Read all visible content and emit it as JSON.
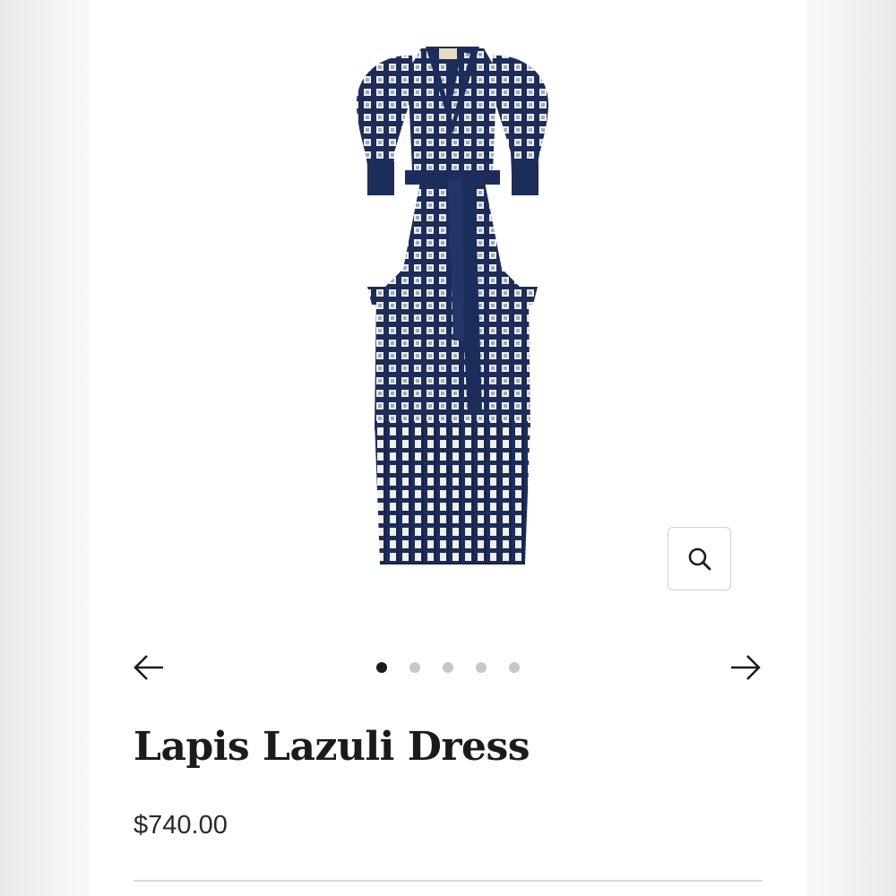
{
  "product": {
    "title": "Lapis Lazuli Dress",
    "price": "$740.00",
    "image": {
      "subject": "navy-blue-white-check-tiered-dress",
      "colors": {
        "primary": "#1c2d5c",
        "pattern": "#f2f0ea"
      }
    }
  },
  "gallery": {
    "slide_count": 5,
    "active_index": 0,
    "prev_icon": "arrow-left-icon",
    "next_icon": "arrow-right-icon",
    "zoom_icon": "magnifier-icon"
  },
  "colors": {
    "card_background": "#ffffff",
    "text": "#1b1b1b",
    "dot_active": "#1a1a1a",
    "dot_inactive": "#c7c7c7"
  }
}
